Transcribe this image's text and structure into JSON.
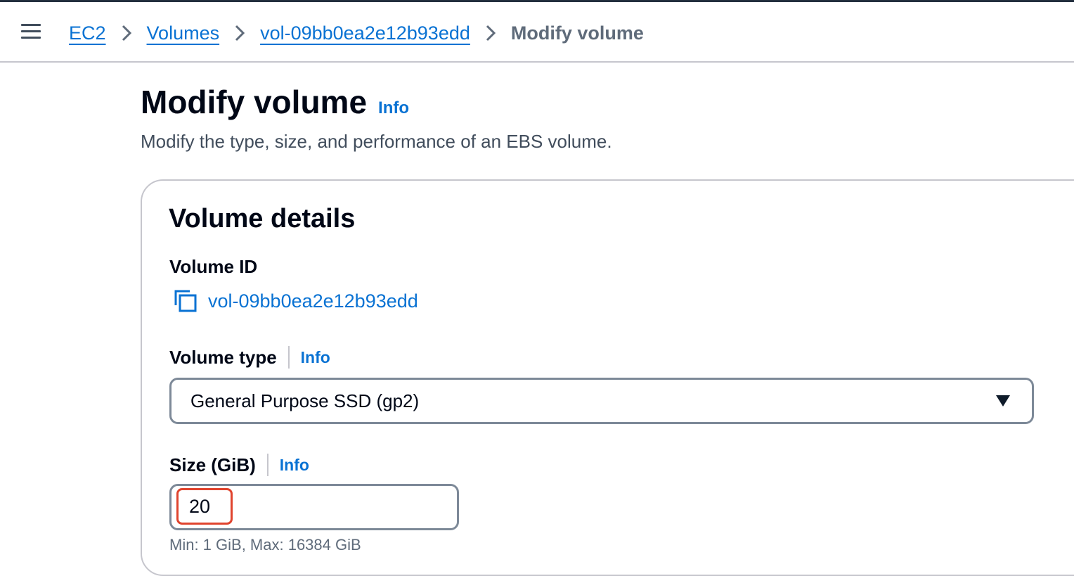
{
  "breadcrumb": {
    "items": [
      {
        "label": "EC2"
      },
      {
        "label": "Volumes"
      },
      {
        "label": "vol-09bb0ea2e12b93edd"
      }
    ],
    "current": "Modify volume"
  },
  "page": {
    "title": "Modify volume",
    "info_label": "Info",
    "description": "Modify the type, size, and performance of an EBS volume."
  },
  "volume_details": {
    "section_title": "Volume details",
    "volume_id_label": "Volume ID",
    "volume_id_value": "vol-09bb0ea2e12b93edd",
    "volume_type_label": "Volume type",
    "volume_type_info": "Info",
    "volume_type_selected": "General Purpose SSD (gp2)",
    "size_label": "Size (GiB)",
    "size_info": "Info",
    "size_value": "20",
    "size_constraint": "Min: 1 GiB, Max: 16384 GiB"
  },
  "colors": {
    "link": "#0972d3",
    "highlight": "#e0442e",
    "border": "#7d8998"
  },
  "icons": [
    "menu-icon",
    "chevron-right-icon",
    "copy-icon",
    "caret-down-icon"
  ]
}
